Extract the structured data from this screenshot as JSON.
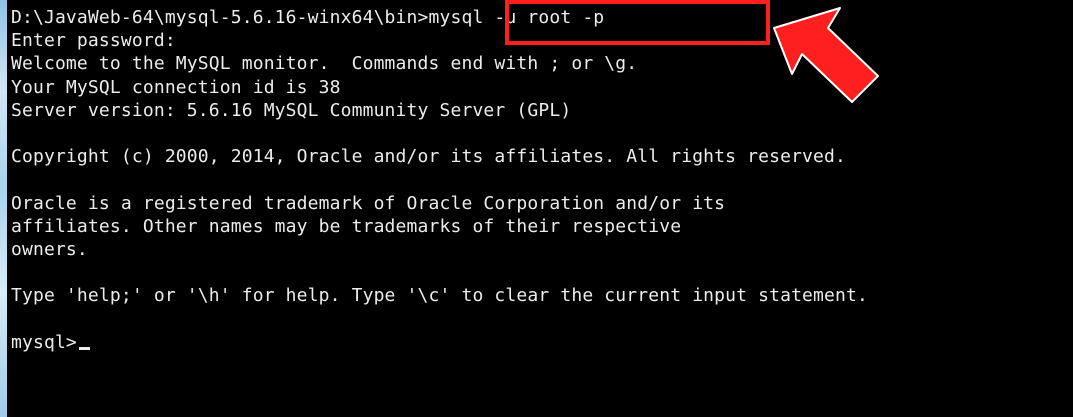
{
  "terminal": {
    "lines": [
      "D:\\JavaWeb-64\\mysql-5.6.16-winx64\\bin>mysql -u root -p",
      "Enter password:",
      "Welcome to the MySQL monitor.  Commands end with ; or \\g.",
      "Your MySQL connection id is 38",
      "Server version: 5.6.16 MySQL Community Server (GPL)",
      "",
      "Copyright (c) 2000, 2014, Oracle and/or its affiliates. All rights reserved.",
      "",
      "Oracle is a registered trademark of Oracle Corporation and/or its",
      "affiliates. Other names may be trademarks of their respective",
      "owners.",
      "",
      "Type 'help;' or '\\h' for help. Type '\\c' to clear the current input statement.",
      "",
      "mysql>"
    ]
  },
  "annotation": {
    "highlight_color": "#ff1f1f",
    "arrow_color": "#ff1f1f",
    "arrow_icon": "pointer-arrow-icon"
  },
  "colors": {
    "background": "#000000",
    "text": "#ececec"
  }
}
